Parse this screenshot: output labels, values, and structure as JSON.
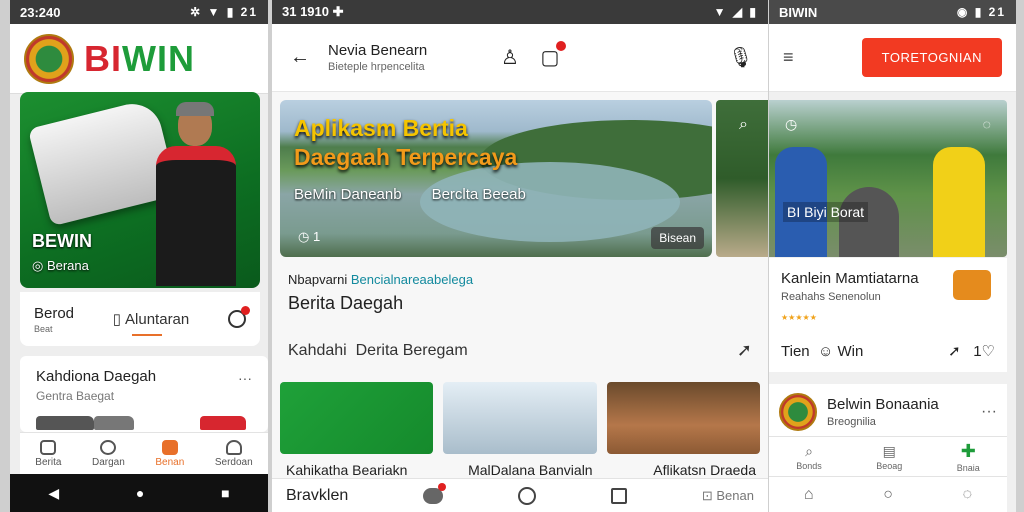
{
  "phone1": {
    "status": {
      "time": "23:240",
      "icons": "✲ ▼ ▮ 21"
    },
    "brand": {
      "name_r": "BI",
      "name_g": "WIN"
    },
    "hero": {
      "title": "BEWIN",
      "subtitle": "◎ Berana"
    },
    "actions": {
      "first_label": "Berod",
      "first_sub": "Beat",
      "second_label": "Aluntaran"
    },
    "card": {
      "title": "Kahdiona Daegah",
      "subtitle": "Gentra Baegat",
      "more": "···"
    },
    "nav": [
      {
        "label": "Berita"
      },
      {
        "label": "Dargan"
      },
      {
        "label": "Benan"
      },
      {
        "label": "Serdoan"
      }
    ],
    "sysbar": {
      "back": "◀",
      "home": "●",
      "recent": "■"
    }
  },
  "phone2": {
    "status": {
      "time": "31 1910",
      "extra": "✚",
      "icons": "▼ ◢ ▮"
    },
    "topbar": {
      "title": "Nevia Benearn",
      "subtitle": "Bieteple hrpencelita",
      "back": "←"
    },
    "hero": {
      "title_line1": "Aplikasm Bertia",
      "title_line2": "Daegaah Terpercaya",
      "meta1": "BeMin Daneanb",
      "meta2": "Berclta Beeab",
      "stat": "◷ 1",
      "tag": "Bisean"
    },
    "section": {
      "kicker_prefix": "Nbapvarni",
      "kicker_link": "Bencialnareaabelega",
      "headline": "Berita Daegah",
      "row_left": "Kahdahi",
      "row_mid": "Derita Beregam"
    },
    "captions": [
      "Kahikatha Beariakn",
      "MalDalana Banvialn",
      "Aflikatsn Draeda"
    ],
    "bottom": {
      "left": "Bravklen",
      "right": "⊡ Benan"
    }
  },
  "phone3": {
    "status": {
      "left": "BIWIN",
      "icons": "◉ ▮ 21"
    },
    "topbar": {
      "menu": "≡",
      "cta": "TORETOGNIAN"
    },
    "hero": {
      "label": "BI Biyi Borat"
    },
    "card": {
      "title": "Kanlein Mamtiatarna",
      "subtitle": "Reahahs Senenolun",
      "stars": "★★★★★",
      "row_left": "Tien",
      "row_mid": "Win",
      "row_right": "1"
    },
    "card2": {
      "title": "Belwin Bonaania",
      "subtitle": "Breognilia",
      "more": "···"
    },
    "nav_top": [
      {
        "label": "Bonds"
      },
      {
        "label": "Beoag"
      },
      {
        "label": "Bnaia"
      }
    ]
  }
}
